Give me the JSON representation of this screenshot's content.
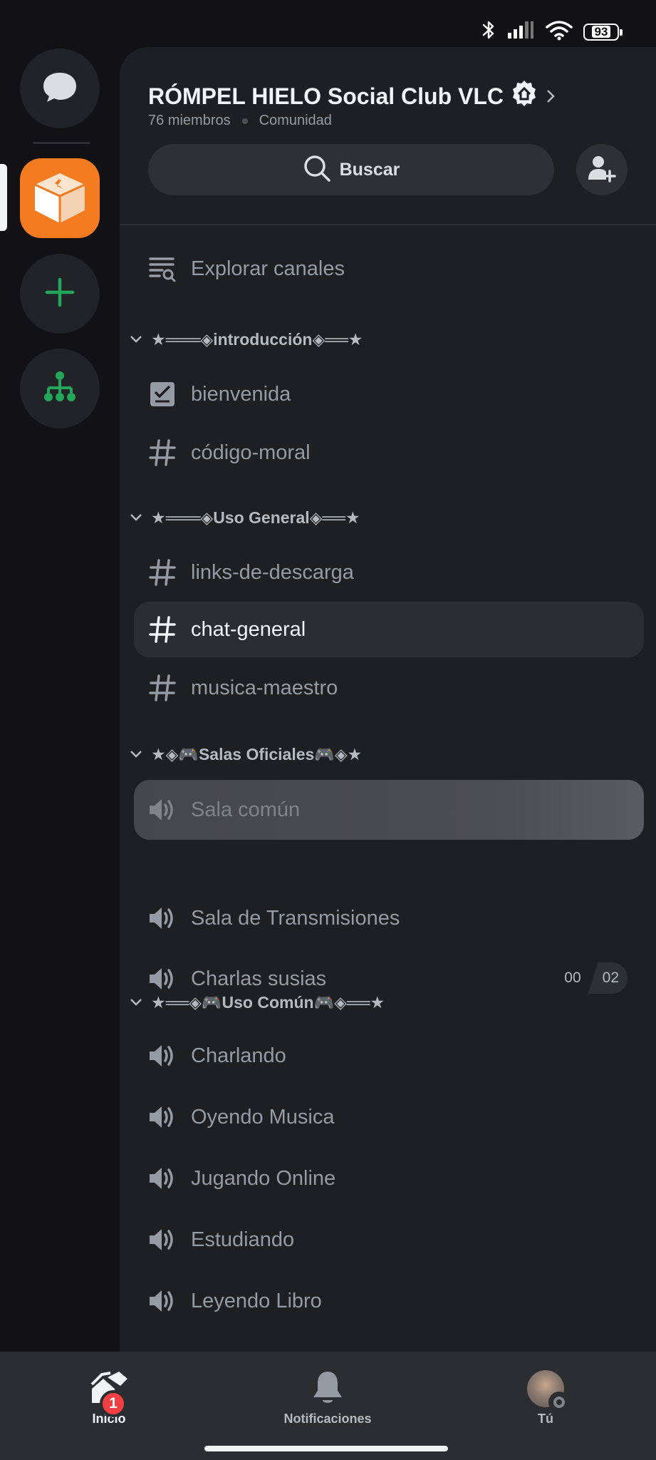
{
  "status_bar": {
    "battery": "93"
  },
  "server": {
    "name": "RÓMPEL HIELO Social Club VLC",
    "members": "76 miembros",
    "type": "Comunidad"
  },
  "search": {
    "label": "Buscar"
  },
  "explore": {
    "label": "Explorar canales"
  },
  "categories": [
    {
      "label": "★═══◈introducción◈══★"
    },
    {
      "label": "★═══◈Uso General◈══★"
    },
    {
      "label": "★◈🎮Salas Oficiales🎮◈★"
    },
    {
      "label": "★══◈🎮Uso Común🎮◈══★"
    }
  ],
  "channels": {
    "bienvenida": "bienvenida",
    "codigo_moral": "código-moral",
    "links": "links-de-descarga",
    "chat_general": "chat-general",
    "musica": "musica-maestro",
    "sala_comun": "Sala común",
    "sala_trans": "Sala de Transmisiones",
    "charlas": "Charlas susias",
    "charlando": "Charlando",
    "oyendo": "Oyendo Musica",
    "jugando": "Jugando Online",
    "estudiando": "Estudiando",
    "leyendo": "Leyendo Libro"
  },
  "charlas_counter": {
    "users": "00",
    "limit": "02"
  },
  "nav": {
    "home": "Inicio",
    "home_badge": "1",
    "notifications": "Notificaciones",
    "you": "Tú"
  },
  "colors": {
    "accent_green": "#23a55a",
    "server_icon_orange": "#f47b20",
    "badge_red": "#f23f43"
  }
}
